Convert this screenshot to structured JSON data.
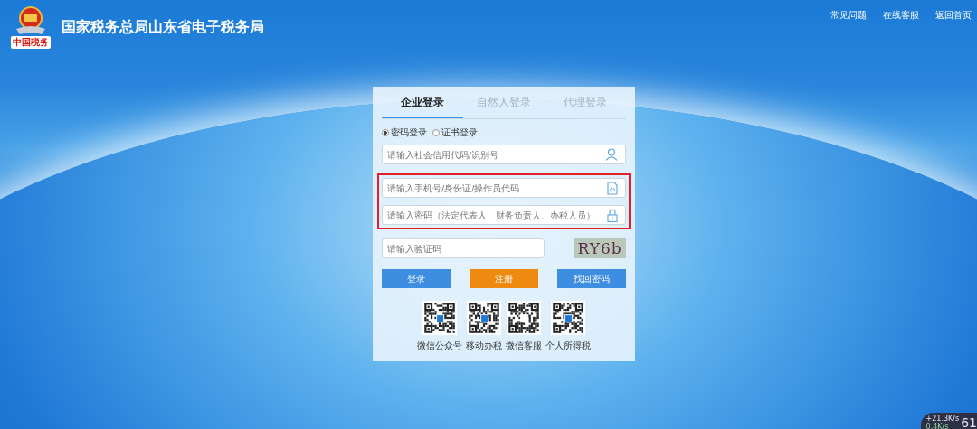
{
  "header": {
    "title": "国家税务总局山东省电子税务局",
    "emblem_caption": "中国税务",
    "links": [
      "常见问题",
      "在线客服",
      "返回首页"
    ]
  },
  "login": {
    "tabs": [
      {
        "label": "企业登录",
        "selected": true
      },
      {
        "label": "自然人登录",
        "selected": false
      },
      {
        "label": "代理登录",
        "selected": false
      }
    ],
    "methods": [
      {
        "label": "密码登录",
        "selected": true
      },
      {
        "label": "证书登录",
        "selected": false
      }
    ],
    "fields": [
      {
        "kind": "user",
        "placeholder": "请输入社会信用代码/识别号",
        "highlighted": false
      },
      {
        "kind": "id",
        "placeholder": "请输入手机号/身份证/操作员代码",
        "highlighted": true
      },
      {
        "kind": "lock",
        "placeholder": "请输入密码（法定代表人、财务负责人、办税人员）",
        "highlighted": true
      }
    ],
    "captcha": {
      "placeholder": "请输入验证码",
      "code": "RY6b"
    },
    "buttons": [
      {
        "label": "登录",
        "kind": "primary"
      },
      {
        "label": "注册",
        "kind": "accent"
      },
      {
        "label": "找回密码",
        "kind": "primary"
      }
    ],
    "qr_codes": [
      "微信公众号",
      "移动办税",
      "微信客服",
      "个人所得税"
    ]
  },
  "speed_widget": {
    "upload": "+21.3K/s",
    "download": "0.4K/s",
    "percent": "61"
  }
}
